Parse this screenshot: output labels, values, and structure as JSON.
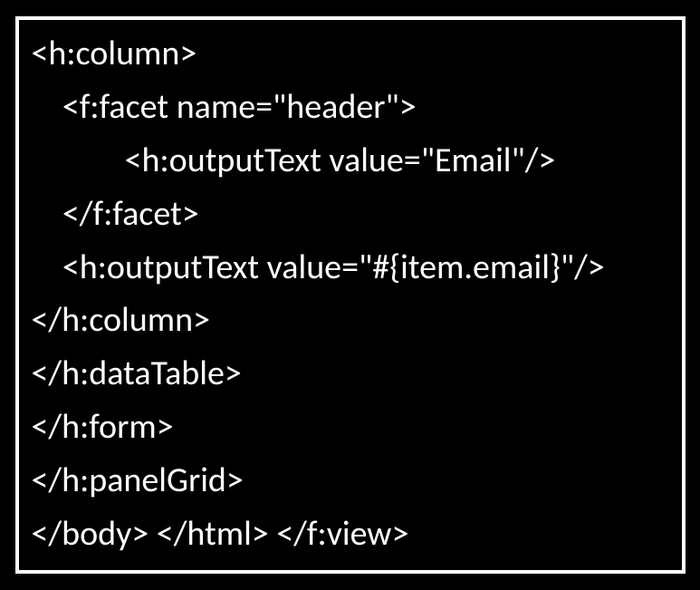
{
  "code": {
    "lines": [
      "<h:column>",
      "    <f:facet name=\"header\">",
      "            <h:outputText value=\"Email\"/>",
      "    </f:facet>",
      "    <h:outputText value=\"#{item.email}\"/>",
      "</h:column>",
      "</h:dataTable>",
      "</h:form>",
      "</h:panelGrid>",
      "</body> </html> </f:view>"
    ]
  }
}
